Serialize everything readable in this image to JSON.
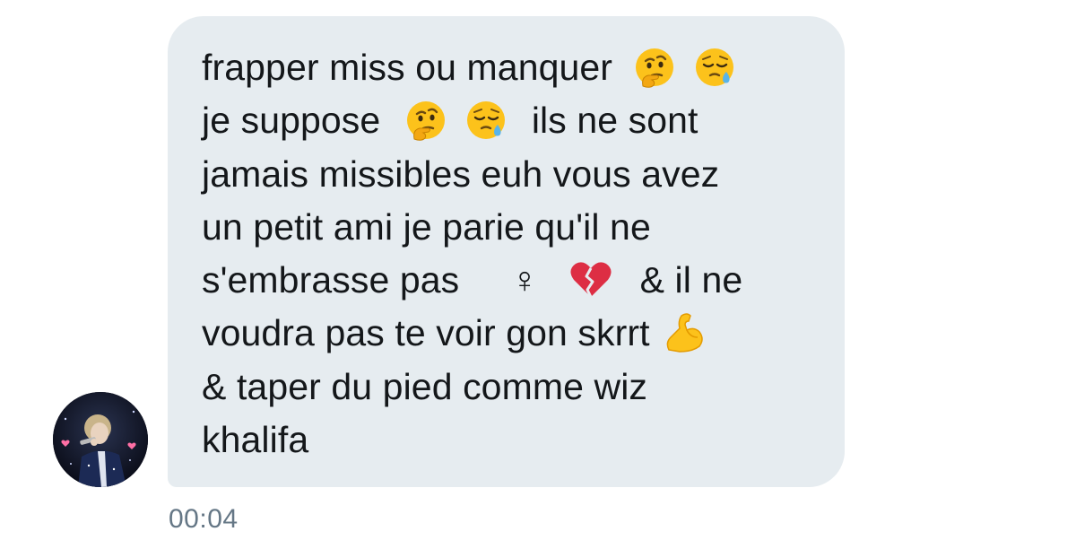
{
  "message": {
    "lines": [
      [
        "frapper miss ou manquer"
      ],
      [
        "je suppose",
        "ils ne sont"
      ],
      [
        "jamais missibles euh vous avez"
      ],
      [
        "un petit ami je parie qu'il ne"
      ],
      [
        "s'embrasse pas",
        "♀",
        "& il ne"
      ],
      [
        "voudra pas te voir gon skrrt"
      ],
      [
        "& taper du pied comme wiz"
      ],
      [
        "khalifa"
      ]
    ],
    "emojis": {
      "thinking": "thinking-face-icon",
      "sleepy": "sleepy-face-icon",
      "broken_heart": "broken-heart-icon",
      "flexed_biceps": "flexed-biceps-icon"
    },
    "timestamp": "00:04"
  },
  "avatar": {
    "icon": "user-avatar"
  },
  "colors": {
    "bubble": "#e6ecf0",
    "text": "#14171a",
    "timestamp": "#657786",
    "background": "#ffffff"
  }
}
